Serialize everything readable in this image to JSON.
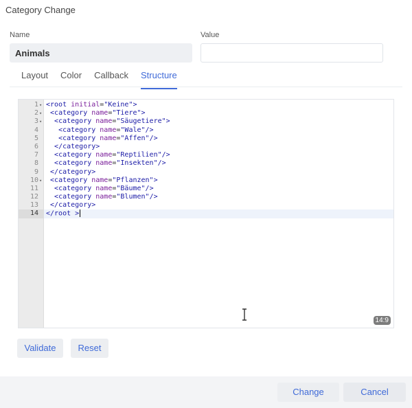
{
  "dialog": {
    "title": "Category  Change"
  },
  "fields": {
    "name_label": "Name",
    "name_value": "Animals",
    "value_label": "Value",
    "value_value": ""
  },
  "tabs": [
    {
      "label": "Layout",
      "active": false
    },
    {
      "label": "Color",
      "active": false
    },
    {
      "label": "Callback",
      "active": false
    },
    {
      "label": "Structure",
      "active": true
    }
  ],
  "editor": {
    "lines": [
      {
        "num": "1",
        "fold": true,
        "indent": "",
        "tokens": [
          [
            "tag",
            "<root"
          ],
          [
            "plain",
            " "
          ],
          [
            "attr",
            "initial"
          ],
          [
            "plain",
            "="
          ],
          [
            "str",
            "\"Keine\""
          ],
          [
            "tag",
            ">"
          ]
        ]
      },
      {
        "num": "2",
        "fold": true,
        "indent": " ",
        "tokens": [
          [
            "tag",
            "<category"
          ],
          [
            "plain",
            " "
          ],
          [
            "attr",
            "name"
          ],
          [
            "plain",
            "="
          ],
          [
            "str",
            "\"Tiere\""
          ],
          [
            "tag",
            ">"
          ]
        ]
      },
      {
        "num": "3",
        "fold": true,
        "indent": "  ",
        "tokens": [
          [
            "tag",
            "<category"
          ],
          [
            "plain",
            " "
          ],
          [
            "attr",
            "name"
          ],
          [
            "plain",
            "="
          ],
          [
            "str",
            "\"Säugetiere\""
          ],
          [
            "tag",
            ">"
          ]
        ]
      },
      {
        "num": "4",
        "fold": false,
        "indent": "   ",
        "tokens": [
          [
            "tag",
            "<category"
          ],
          [
            "plain",
            " "
          ],
          [
            "attr",
            "name"
          ],
          [
            "plain",
            "="
          ],
          [
            "str",
            "\"Wale\""
          ],
          [
            "tag",
            "/>"
          ]
        ]
      },
      {
        "num": "5",
        "fold": false,
        "indent": "   ",
        "tokens": [
          [
            "tag",
            "<category"
          ],
          [
            "plain",
            " "
          ],
          [
            "attr",
            "name"
          ],
          [
            "plain",
            "="
          ],
          [
            "str",
            "\"Affen\""
          ],
          [
            "tag",
            "/>"
          ]
        ]
      },
      {
        "num": "6",
        "fold": false,
        "indent": "  ",
        "tokens": [
          [
            "tag",
            "</category>"
          ]
        ]
      },
      {
        "num": "7",
        "fold": false,
        "indent": "  ",
        "tokens": [
          [
            "tag",
            "<category"
          ],
          [
            "plain",
            " "
          ],
          [
            "attr",
            "name"
          ],
          [
            "plain",
            "="
          ],
          [
            "str",
            "\"Reptilien\""
          ],
          [
            "tag",
            "/>"
          ]
        ]
      },
      {
        "num": "8",
        "fold": false,
        "indent": "  ",
        "tokens": [
          [
            "tag",
            "<category"
          ],
          [
            "plain",
            " "
          ],
          [
            "attr",
            "name"
          ],
          [
            "plain",
            "="
          ],
          [
            "str",
            "\"Insekten\""
          ],
          [
            "tag",
            "/>"
          ]
        ]
      },
      {
        "num": "9",
        "fold": false,
        "indent": " ",
        "tokens": [
          [
            "tag",
            "</category>"
          ]
        ]
      },
      {
        "num": "10",
        "fold": true,
        "indent": " ",
        "tokens": [
          [
            "tag",
            "<category"
          ],
          [
            "plain",
            " "
          ],
          [
            "attr",
            "name"
          ],
          [
            "plain",
            "="
          ],
          [
            "str",
            "\"Pflanzen\""
          ],
          [
            "tag",
            ">"
          ]
        ]
      },
      {
        "num": "11",
        "fold": false,
        "indent": "  ",
        "tokens": [
          [
            "tag",
            "<category"
          ],
          [
            "plain",
            " "
          ],
          [
            "attr",
            "name"
          ],
          [
            "plain",
            "="
          ],
          [
            "str",
            "\"Bäume\""
          ],
          [
            "tag",
            "/>"
          ]
        ]
      },
      {
        "num": "12",
        "fold": false,
        "indent": "  ",
        "tokens": [
          [
            "tag",
            "<category"
          ],
          [
            "plain",
            " "
          ],
          [
            "attr",
            "name"
          ],
          [
            "plain",
            "="
          ],
          [
            "str",
            "\"Blumen\""
          ],
          [
            "tag",
            "/>"
          ]
        ]
      },
      {
        "num": "13",
        "fold": false,
        "indent": " ",
        "tokens": [
          [
            "tag",
            "</category>"
          ]
        ]
      },
      {
        "num": "14",
        "fold": false,
        "indent": "",
        "tokens": [
          [
            "tag",
            "</root >"
          ]
        ],
        "active": true,
        "cursor": true
      }
    ],
    "cursor_position": "14:9"
  },
  "buttons": {
    "validate": "Validate",
    "reset": "Reset",
    "change": "Change",
    "cancel": "Cancel"
  },
  "colors": {
    "accent": "#3f6ad8",
    "button_bg": "#eceef1",
    "footer_bg": "#f3f4f6"
  }
}
